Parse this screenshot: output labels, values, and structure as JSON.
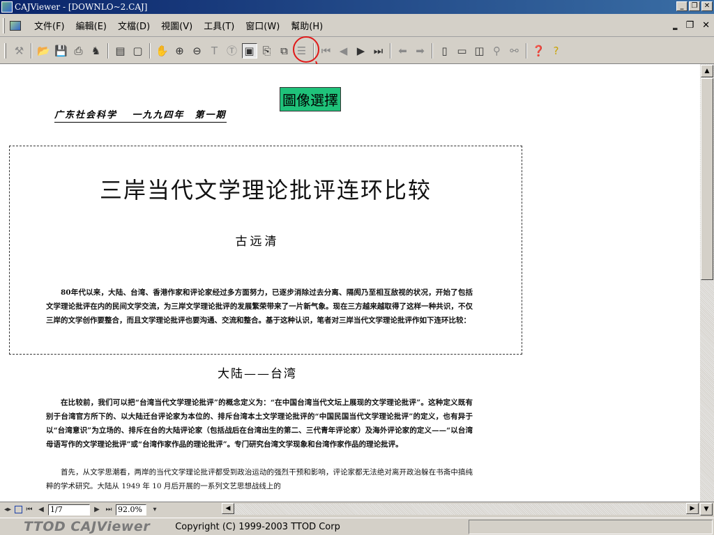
{
  "window": {
    "title": "CAJViewer - [DOWNLO~2.CAJ]",
    "minimize": "_",
    "maximize": "❐",
    "close": "✕"
  },
  "menu": {
    "items": [
      "文件(F)",
      "編輯(E)",
      "文檔(D)",
      "視圖(V)",
      "工具(T)",
      "窗口(W)",
      "幫助(H)"
    ],
    "right_controls": [
      "‗",
      "❐",
      "✕"
    ]
  },
  "toolbar": {
    "groups": [
      [
        "tools-icon"
      ],
      [
        "open-folder-icon",
        "save-icon",
        "print-icon",
        "bookmark-icon"
      ],
      [
        "thumbnail-view-icon",
        "page-view-icon"
      ],
      [
        "hand-tool-icon",
        "zoom-in-icon",
        "zoom-out-icon",
        "select-text-icon",
        "text-icon",
        "select-image-icon",
        "copy-icon",
        "snapshot-icon",
        "properties-icon"
      ],
      [
        "first-page-icon",
        "prev-page-icon",
        "next-page-icon",
        "last-page-icon"
      ],
      [
        "back-icon",
        "forward-icon"
      ],
      [
        "single-page-icon",
        "continuous-icon",
        "facing-icon",
        "find-icon",
        "find-next-icon"
      ],
      [
        "help-icon",
        "whats-this-icon"
      ]
    ],
    "active_tool": "select-image-icon"
  },
  "annotation": {
    "label": "圖像選擇"
  },
  "document": {
    "journal_line": "广东社会科学　 一九九四年　第一期",
    "title": "三岸当代文学理论批评连环比较",
    "author": "古远清",
    "paragraph1": "80年代以来，大陆、台湾、香港作家和评论家经过多方面努力，已逐步消除过去分离、隔阂乃至相互敌视的状况，开始了包括文学理论批评在内的民间文学交流，为三岸文学理论批评的发展繁荣带来了一片新气象。现在三方越来越取得了这样一种共识，不仅三岸的文学创作要整合，而且文学理论批评也要沟通、交流和整合。基于这种认识，笔者对三岸当代文学理论批评作如下连环比较：",
    "section_heading": "大陆——台湾",
    "paragraph2": "在比较前，我们可以把“台湾当代文学理论批评”的概念定义为：“在中国台湾当代文坛上展现的文学理论批评”。这种定义既有别于台湾官方所下的、以大陆迁台评论家为本位的、排斥台湾本土文学理论批评的“中国民国当代文学理论批评”的定义，也有异于以“台湾意识”为立场的、排斥在台的大陆评论家（包括战后在台湾出生的第二、三代青年评论家）及海外评论家的定义——“以台湾母语写作的文学理论批评”或“台湾作家作品的理论批评”。专门研究台湾文学现象和台湾作家作品的理论批评。",
    "paragraph3": "首先，从文学思潮看，两岸的当代文学理论批评都受到政治运动的强烈干预和影响，评论家都无法绝对离开政治躲在书斋中搞纯粹的学术研究。大陆从 1949 年 10 月后开展的一系列文艺思想战线上的"
  },
  "navigation": {
    "page": "1/7",
    "zoom": "92.0%"
  },
  "status": {
    "brand": "TTOD CAJViewer",
    "copyright": "Copyright (C) 1999-2003 TTOD Corp"
  }
}
